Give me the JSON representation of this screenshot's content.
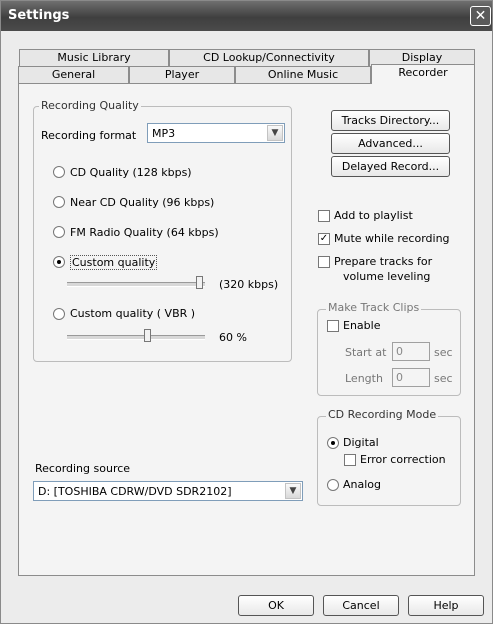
{
  "window": {
    "title": "Settings"
  },
  "tabs": {
    "row1": [
      "Music Library",
      "CD Lookup/Connectivity",
      "Display"
    ],
    "row2": [
      "General",
      "Player",
      "Online Music",
      "Recorder"
    ]
  },
  "recording_quality": {
    "legend": "Recording Quality",
    "format_label": "Recording format",
    "format_value": "MP3",
    "options": {
      "cd": "CD Quality (128 kbps)",
      "near_cd": "Near CD Quality (96 kbps)",
      "fm": "FM Radio Quality (64 kbps)",
      "custom": "Custom quality",
      "custom_vbr": "Custom quality ( VBR )"
    },
    "selected": "custom",
    "custom_bitrate": "(320 kbps)",
    "custom_level": 1.0,
    "vbr_percent": "60 %",
    "vbr_level": 0.6
  },
  "recording_source": {
    "label": "Recording source",
    "value": "D: [TOSHIBA CDRW/DVD SDR2102]"
  },
  "buttons": {
    "tracks_directory": "Tracks Directory...",
    "advanced": "Advanced...",
    "delayed_record": "Delayed Record..."
  },
  "options": {
    "add_to_playlist": {
      "label": "Add to playlist",
      "checked": false
    },
    "mute_while_recording": {
      "label": "Mute while recording",
      "checked": true
    },
    "prepare_tracks_line1": "Prepare tracks for",
    "prepare_tracks_line2": "volume leveling",
    "prepare_tracks_checked": false
  },
  "make_track_clips": {
    "legend": "Make Track Clips",
    "enable": "Enable",
    "start_at": "Start at",
    "start_value": "0",
    "length": "Length",
    "length_value": "0",
    "unit": "sec"
  },
  "cd_recording_mode": {
    "legend": "CD Recording Mode",
    "digital": "Digital",
    "error_correction": "Error correction",
    "analog": "Analog",
    "selected": "digital"
  },
  "dialog_buttons": {
    "ok": "OK",
    "cancel": "Cancel",
    "help": "Help"
  }
}
